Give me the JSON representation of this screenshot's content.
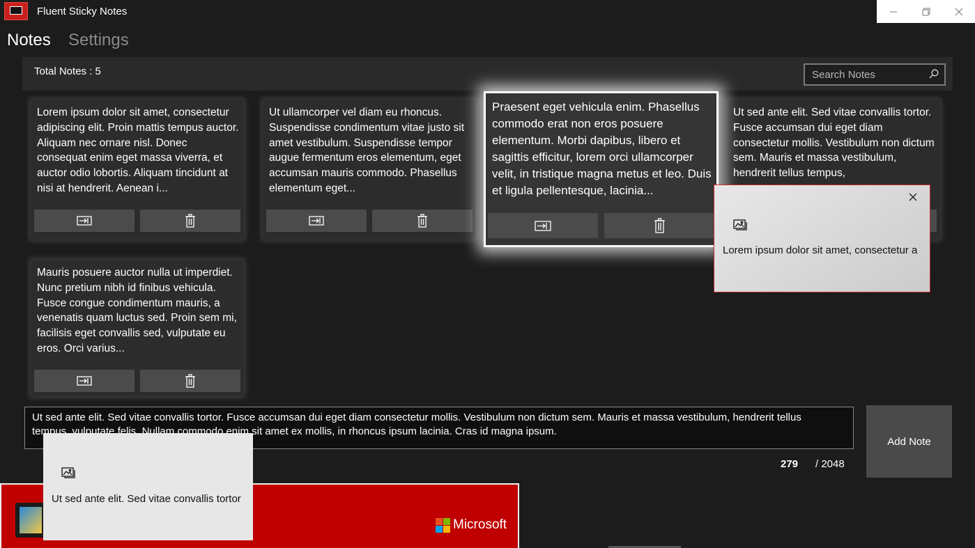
{
  "window": {
    "title": "Fluent Sticky Notes"
  },
  "nav": {
    "notes": "Notes",
    "settings": "Settings"
  },
  "header": {
    "total_label": "Total Notes :  5",
    "search_placeholder": "Search Notes"
  },
  "notes": [
    {
      "text": "Lorem ipsum dolor sit amet, consectetur adipiscing elit. Proin mattis tempus auctor. Aliquam nec ornare nisl. Donec consequat enim eget massa viverra, et auctor odio lobortis. Aliquam tincidunt at nisi at hendrerit. Aenean i..."
    },
    {
      "text": "Ut ullamcorper vel diam eu rhoncus. Suspendisse condimentum vitae justo sit amet vestibulum. Suspendisse tempor augue fermentum eros elementum, eget accumsan mauris commodo. Phasellus elementum eget..."
    },
    {
      "text": "Praesent eget vehicula enim. Phasellus commodo erat non eros posuere elementum. Morbi dapibus, libero et sagittis efficitur, lorem orci ullamcorper velit, in tristique magna metus et leo. Duis et ligula pellentesque, lacinia..."
    },
    {
      "text": "Ut sed ante elit. Sed vitae convallis tortor. Fusce accumsan dui eget diam consectetur mollis. Vestibulum non dictum sem. Mauris et massa vestibulum, hendrerit tellus tempus,"
    },
    {
      "text": "Mauris posuere auctor nulla ut imperdiet. Nunc pretium nibh id finibus vehicula. Fusce congue condimentum mauris, a venenatis quam luctus sed. Proin sem mi, facilisis eget convallis sed, vulputate eu eros. Orci varius..."
    }
  ],
  "popups": [
    {
      "text": "Lorem ipsum dolor sit amet, consectetur a"
    },
    {
      "text": "Ut sed ante elit. Sed vitae convallis tortor"
    }
  ],
  "editor": {
    "text": "Ut sed ante elit. Sed vitae convallis tortor. Fusce accumsan dui eget diam consectetur mollis. Vestibulum non dictum sem. Mauris et massa vestibulum, hendrerit tellus tempus, vulputate felis. Nullam commodo enim sit amet ex mollis, in rhoncus ipsum lacinia. Cras id magna ipsum.",
    "char_count": "279",
    "char_max": "/ 2048",
    "add_label": "Add Note"
  },
  "banner": {
    "brand": "Microsoft"
  },
  "colors": {
    "background": "#1c1c1c",
    "card": "#2c2c2c",
    "button": "#4b4b4b",
    "banner": "#c00000",
    "ms_red": "#f25022",
    "ms_green": "#7fba00",
    "ms_blue": "#00a4ef",
    "ms_yellow": "#ffb900"
  },
  "icons": {
    "open_note": "open-note-icon",
    "delete": "trash-icon",
    "search": "search-icon",
    "close": "close-icon",
    "image": "image-icon"
  }
}
